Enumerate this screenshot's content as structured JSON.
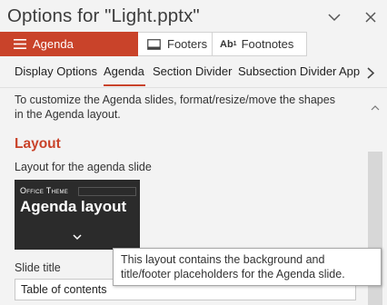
{
  "window": {
    "title": "Options for \"Light.pptx\"",
    "dropdown_icon": "chevron-down-icon",
    "close_icon": "close-icon"
  },
  "top_tabs": [
    {
      "label": "Agenda",
      "icon": "hamburger-icon",
      "active": true
    },
    {
      "label": "Footers",
      "icon": "footer-icon",
      "active": false
    },
    {
      "label": "Footnotes",
      "icon": "footnote-icon",
      "active": false
    }
  ],
  "sub_tabs": [
    {
      "label": "Display Options",
      "active": false
    },
    {
      "label": "Agenda",
      "active": true
    },
    {
      "label": "Section Divider",
      "active": false
    },
    {
      "label": "Subsection Divider",
      "active": false
    },
    {
      "label": "App",
      "active": false
    }
  ],
  "content": {
    "intro_text": "To customize the Agenda slides, format/resize/move the shapes in the Agenda layout.",
    "section_heading": "Layout",
    "layout_label": "Layout for the agenda slide",
    "preview": {
      "theme_label": "Office Theme",
      "heading": "Agenda layout"
    },
    "slide_title_label": "Slide title",
    "slide_title_value": "Table of contents",
    "tooltip": "This layout contains the background and title/footer placeholders for the Agenda slide."
  },
  "colors": {
    "accent": "#c9432a",
    "background": "#f3f3f3"
  }
}
